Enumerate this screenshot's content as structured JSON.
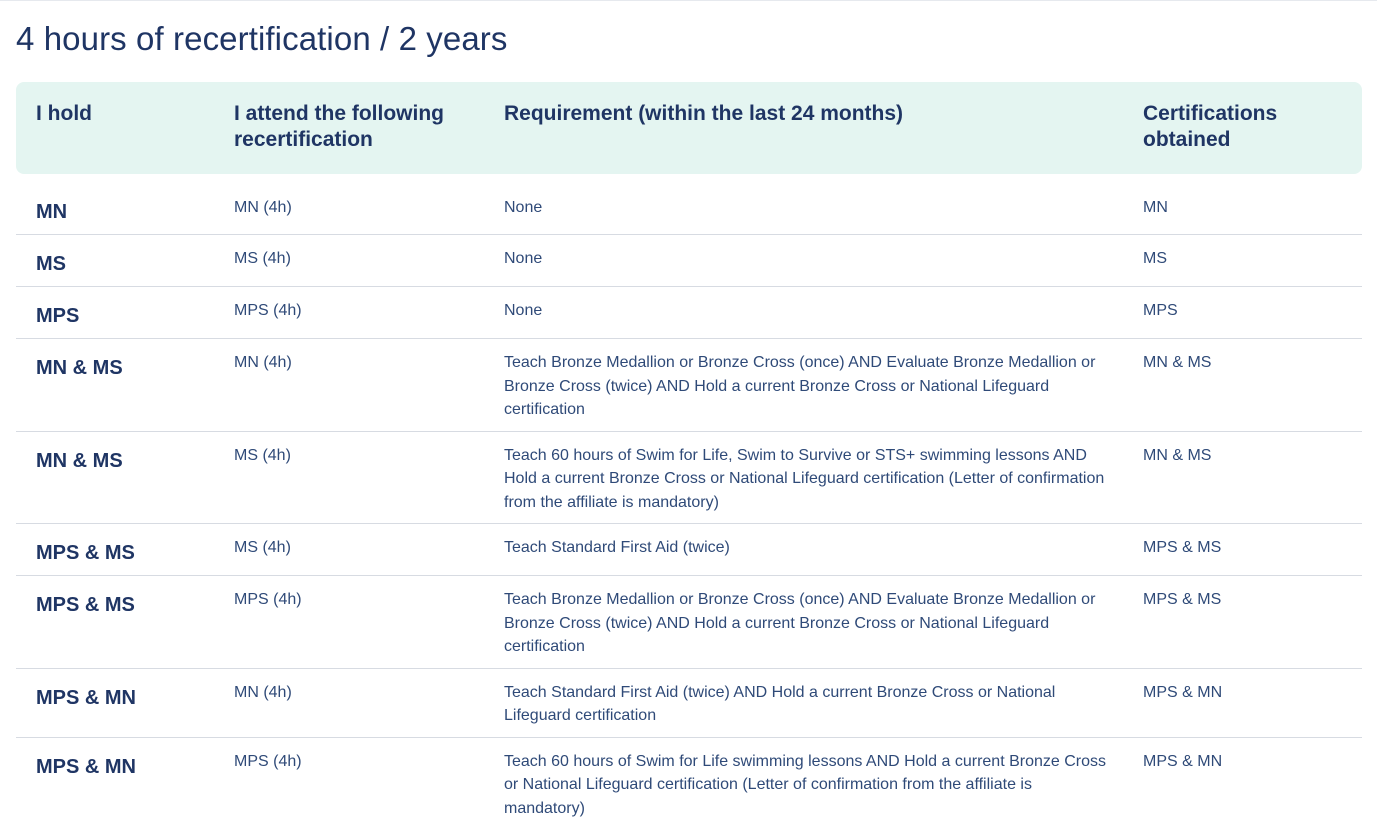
{
  "page": {
    "title": "4 hours of recertification / 2 years"
  },
  "table": {
    "headers": [
      "I hold",
      "I attend the following recertification",
      "Requirement (within the last 24 months)",
      "Certifications obtained"
    ],
    "rows": [
      {
        "hold": "MN",
        "attend": "MN (4h)",
        "requirement": "None",
        "obtained": "MN"
      },
      {
        "hold": "MS",
        "attend": "MS (4h)",
        "requirement": "None",
        "obtained": "MS"
      },
      {
        "hold": "MPS",
        "attend": "MPS (4h)",
        "requirement": "None",
        "obtained": "MPS"
      },
      {
        "hold": "MN & MS",
        "attend": "MN (4h)",
        "requirement": "Teach Bronze Medallion or Bronze Cross (once) AND Evaluate Bronze Medallion or Bronze Cross (twice) AND Hold a current Bronze Cross or National Lifeguard certification",
        "obtained": "MN & MS"
      },
      {
        "hold": "MN & MS",
        "attend": "MS (4h)",
        "requirement": "Teach 60 hours of Swim for Life, Swim to Survive or STS+ swimming lessons AND Hold a current Bronze Cross or National Lifeguard certification (Letter of confirmation from the affiliate is mandatory)",
        "obtained": "MN & MS"
      },
      {
        "hold": "MPS & MS",
        "attend": "MS (4h)",
        "requirement": "Teach Standard First Aid (twice)",
        "obtained": "MPS & MS"
      },
      {
        "hold": "MPS & MS",
        "attend": "MPS (4h)",
        "requirement": "Teach Bronze Medallion or Bronze Cross (once) AND Evaluate Bronze Medallion or Bronze Cross (twice) AND Hold a current Bronze Cross or National Lifeguard certification",
        "obtained": "MPS & MS"
      },
      {
        "hold": "MPS & MN",
        "attend": "MN (4h)",
        "requirement": "Teach Standard First Aid (twice) AND Hold a current Bronze Cross or National Lifeguard certification",
        "obtained": "MPS & MN"
      },
      {
        "hold": "MPS & MN",
        "attend": "MPS (4h)",
        "requirement": "Teach 60 hours of Swim for Life swimming lessons AND Hold a current Bronze Cross or National Lifeguard certification (Letter of confirmation from the affiliate is mandatory)",
        "obtained": "MPS & MN"
      }
    ]
  },
  "colors": {
    "heading_text": "#1f3564",
    "body_text": "#2f4a78",
    "header_background": "#e4f5f1",
    "row_divider": "#d7dbe2"
  }
}
